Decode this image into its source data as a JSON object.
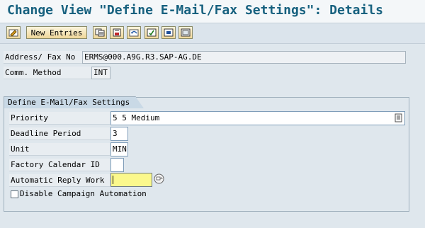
{
  "title": "Change View \"Define E-Mail/Fax Settings\": Details",
  "toolbar": {
    "buttons": [
      {
        "name": "edit-icon"
      },
      {
        "label": "New Entries"
      },
      {
        "name": "copy-icon"
      },
      {
        "name": "delete-icon"
      },
      {
        "name": "undo-icon"
      },
      {
        "name": "select-all-icon"
      },
      {
        "name": "select-block-icon"
      },
      {
        "name": "deselect-all-icon"
      }
    ]
  },
  "header_fields": {
    "address": {
      "label": "Address/ Fax No",
      "value": "ERMS@000.A9G.R3.SAP-AG.DE"
    },
    "comm_method": {
      "label": "Comm. Method",
      "value": "INT"
    }
  },
  "group": {
    "title": "Define E-Mail/Fax Settings",
    "priority": {
      "label": "Priority",
      "value": "5 5 Medium"
    },
    "deadline": {
      "label": "Deadline Period",
      "value": "3"
    },
    "unit": {
      "label": "Unit",
      "value": "MIN"
    },
    "factory_calendar": {
      "label": "Factory Calendar ID",
      "value": ""
    },
    "auto_reply": {
      "label": "Automatic Reply Work",
      "value": ""
    },
    "disable_campaign": {
      "label": "Disable Campaign Automation",
      "checked": false
    }
  }
}
